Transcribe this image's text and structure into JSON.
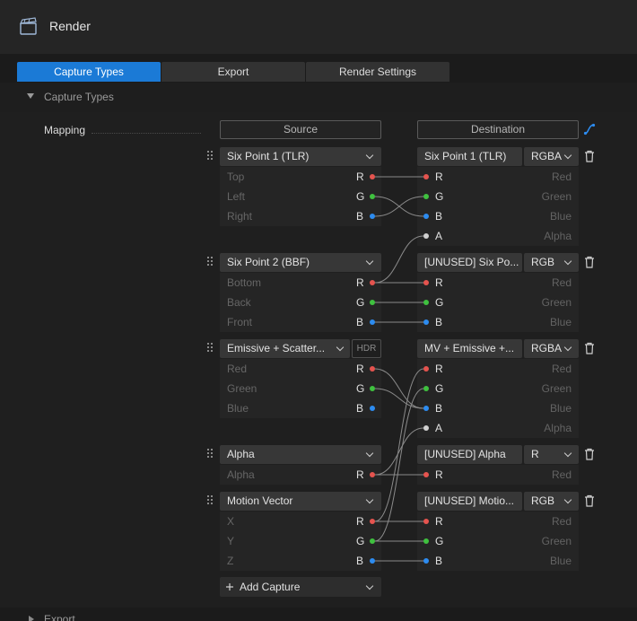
{
  "header": {
    "title": "Render",
    "icon": "clapperboard-icon"
  },
  "tabs": [
    {
      "label": "Capture Types",
      "active": true
    },
    {
      "label": "Export",
      "active": false
    },
    {
      "label": "Render Settings",
      "active": false
    }
  ],
  "section": {
    "title": "Capture Types",
    "expanded": true
  },
  "mapping": {
    "label": "Mapping",
    "source_header": "Source",
    "destination_header": "Destination"
  },
  "captures": [
    {
      "source": "Six Point 1 (TLR)",
      "hdr": false,
      "channels": [
        {
          "name": "Top",
          "ch": "R",
          "color": "#e5544f"
        },
        {
          "name": "Left",
          "ch": "G",
          "color": "#3fc13f"
        },
        {
          "name": "Right",
          "ch": "B",
          "color": "#2d8cf0"
        }
      ],
      "dest": "Six Point 1 (TLR)",
      "format": "RGBA",
      "dest_channels": [
        {
          "ch": "R",
          "name": "Red",
          "color": "#e5544f"
        },
        {
          "ch": "G",
          "name": "Green",
          "color": "#3fc13f"
        },
        {
          "ch": "B",
          "name": "Blue",
          "color": "#2d8cf0"
        },
        {
          "ch": "A",
          "name": "Alpha",
          "color": "#d0d0d0"
        }
      ]
    },
    {
      "source": "Six Point 2 (BBF)",
      "hdr": false,
      "channels": [
        {
          "name": "Bottom",
          "ch": "R",
          "color": "#e5544f"
        },
        {
          "name": "Back",
          "ch": "G",
          "color": "#3fc13f"
        },
        {
          "name": "Front",
          "ch": "B",
          "color": "#2d8cf0"
        }
      ],
      "dest": "[UNUSED] Six Po...",
      "format": "RGB",
      "dest_channels": [
        {
          "ch": "R",
          "name": "Red",
          "color": "#e5544f"
        },
        {
          "ch": "G",
          "name": "Green",
          "color": "#3fc13f"
        },
        {
          "ch": "B",
          "name": "Blue",
          "color": "#2d8cf0"
        }
      ]
    },
    {
      "source": "Emissive + Scatter...",
      "hdr": true,
      "hdr_label": "HDR",
      "channels": [
        {
          "name": "Red",
          "ch": "R",
          "color": "#e5544f"
        },
        {
          "name": "Green",
          "ch": "G",
          "color": "#3fc13f"
        },
        {
          "name": "Blue",
          "ch": "B",
          "color": "#2d8cf0"
        }
      ],
      "dest": "MV + Emissive +...",
      "format": "RGBA",
      "dest_channels": [
        {
          "ch": "R",
          "name": "Red",
          "color": "#e5544f"
        },
        {
          "ch": "G",
          "name": "Green",
          "color": "#3fc13f"
        },
        {
          "ch": "B",
          "name": "Blue",
          "color": "#2d8cf0"
        },
        {
          "ch": "A",
          "name": "Alpha",
          "color": "#d0d0d0"
        }
      ]
    },
    {
      "source": "Alpha",
      "hdr": false,
      "channels": [
        {
          "name": "Alpha",
          "ch": "R",
          "color": "#e5544f"
        }
      ],
      "dest": "[UNUSED] Alpha",
      "format": "R",
      "dest_channels": [
        {
          "ch": "R",
          "name": "Red",
          "color": "#e5544f"
        }
      ]
    },
    {
      "source": "Motion Vector",
      "hdr": false,
      "channels": [
        {
          "name": "X",
          "ch": "R",
          "color": "#e5544f"
        },
        {
          "name": "Y",
          "ch": "G",
          "color": "#3fc13f"
        },
        {
          "name": "Z",
          "ch": "B",
          "color": "#2d8cf0"
        }
      ],
      "dest": "[UNUSED] Motio...",
      "format": "RGB",
      "dest_channels": [
        {
          "ch": "R",
          "name": "Red",
          "color": "#e5544f"
        },
        {
          "ch": "G",
          "name": "Green",
          "color": "#3fc13f"
        },
        {
          "ch": "B",
          "name": "Blue",
          "color": "#2d8cf0"
        }
      ]
    }
  ],
  "add_capture_label": "Add Capture",
  "next_section": {
    "title": "Export",
    "expanded": false
  },
  "colors": {
    "accent": "#1b7ad6",
    "red": "#e5544f",
    "green": "#3fc13f",
    "blue": "#2d8cf0"
  }
}
